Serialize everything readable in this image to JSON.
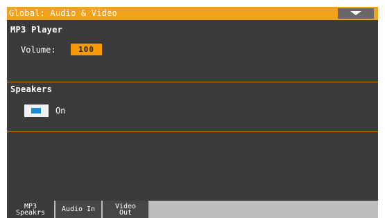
{
  "header": {
    "title": "Global: Audio & Video",
    "menu_icon": "chevron-down-icon"
  },
  "mp3_player": {
    "title": "MP3 Player",
    "volume_label": "Volume:",
    "volume_value": "100"
  },
  "speakers": {
    "title": "Speakers",
    "checkbox_checked": true,
    "checkbox_label": "On"
  },
  "tabs": [
    {
      "line1": "MP3",
      "line2": "Speakrs",
      "selected": true
    },
    {
      "line1": "Audio In",
      "line2": "",
      "selected": false
    },
    {
      "line1": "Video",
      "line2": "Out",
      "selected": false
    }
  ],
  "colors": {
    "accent": "#f0a21a",
    "background": "#3b3b3d",
    "checkbox_mark": "#1a8fd6",
    "value_field": "#f79b00"
  }
}
